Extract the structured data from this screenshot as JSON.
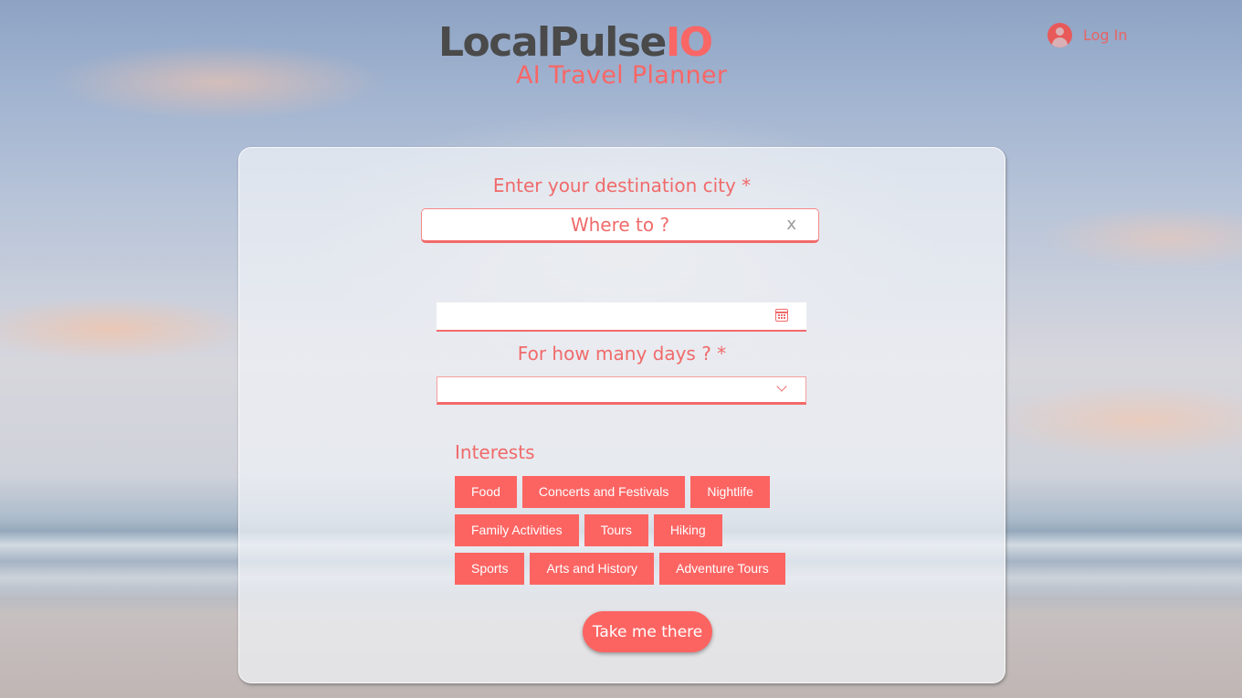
{
  "header": {
    "logo_main": "LocalPulse",
    "logo_accent": "IO",
    "subtitle": "AI Travel Planner",
    "login_label": "Log In"
  },
  "form": {
    "destination_label": "Enter your destination city *",
    "destination_placeholder": "Where to ?",
    "destination_value": "",
    "clear_glyph": "x",
    "date_value": "",
    "days_label": "For how many days ? *",
    "days_selected": "",
    "interests_title": "Interests",
    "interests": [
      [
        "Food",
        "Concerts and Festivals",
        "Nightlife"
      ],
      [
        "Family Activities",
        "Tours",
        "Hiking"
      ],
      [
        "Sports",
        "Arts and History",
        "Adventure Tours"
      ]
    ],
    "submit_label": "Take me there"
  },
  "icons": {
    "login": "user-avatar-icon",
    "calendar": "calendar-icon",
    "dropdown": "chevron-down-icon",
    "clear": "close-icon"
  },
  "colors": {
    "accent": "#fc6462",
    "logo_dark": "#4a4a4a"
  }
}
